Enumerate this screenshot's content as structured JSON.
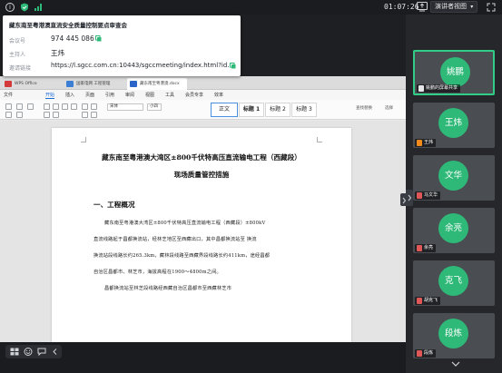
{
  "topbar": {
    "time": "01:07:26",
    "view_label": "演讲者视图",
    "icons": [
      "info-icon",
      "shield-icon",
      "signal-icon",
      "share-screen-icon",
      "chevron-down-icon",
      "fullscreen-icon"
    ]
  },
  "meeting_info": {
    "title": "藏东南至粤港澳直流安全质量控制要点审查会",
    "rows": [
      {
        "label": "会议号",
        "value": "974 445 086"
      },
      {
        "label": "主持人",
        "value": "王炜"
      },
      {
        "label": "邀请链接",
        "value": "https://l.sgcc.com.cn:10443/sgccmeeting/index.html?id..."
      }
    ]
  },
  "document_app": {
    "tabs": [
      {
        "label": "WPS Office",
        "color": "#d33b3b"
      },
      {
        "label": "国家电网 工程管理",
        "color": "#3b7ed3"
      },
      {
        "label": "藏东南至粤港澳.docx",
        "color": "#2a65c7"
      }
    ],
    "menu": [
      "文件",
      "开始",
      "插入",
      "页面",
      "引用",
      "审阅",
      "视图",
      "工具",
      "会员专享",
      "效率"
    ],
    "selected_menu": "开始",
    "font_name": "宋体",
    "font_size": "小四",
    "styles": [
      "正文",
      "标题 1",
      "标题 2",
      "标题 3"
    ],
    "ribbon_right": [
      "查找替换",
      "选择"
    ]
  },
  "document": {
    "title_line1": "藏东南至粤港澳大湾区±800千伏特高压直流输电工程（西藏段）",
    "title_line2": "现场质量管控措施",
    "heading": "一、工程概况",
    "paragraph_lines": [
      "藏东南至粤港澳大湾区±800千伏特高压直流输电工程（西藏段）±800kV",
      "直流线路起于昌都换流站，经林芝地区至西藏出口，其中昌都换流站至   换流",
      "换流站段线路长约265.3km，藏林段线路至西藏界段线路长约411km，途经昌都",
      "自治区昌都市、林芝市，海拔高程在1900～4800m之间。",
      "昌都换流站至林芝段线路经西藏自治区昌都市至西藏林芝市"
    ]
  },
  "participants": [
    {
      "initials": "姚鹏",
      "name": "姚鹏的屏幕共享",
      "active": true,
      "color": "#2fb978"
    },
    {
      "initials": "王炜",
      "name": "王炜",
      "active": false,
      "color": "#2fb978"
    },
    {
      "initials": "文华",
      "name": "马文华",
      "active": false,
      "color": "#2fb978"
    },
    {
      "initials": "余亮",
      "name": "余亮",
      "active": false,
      "color": "#2fb978"
    },
    {
      "initials": "克飞",
      "name": "胡克飞",
      "active": false,
      "color": "#2fb978"
    },
    {
      "initials": "段炼",
      "name": "段炼",
      "active": false,
      "color": "#2fb978"
    }
  ],
  "bottom_toolbar": {
    "icons": [
      "grid-view-icon",
      "reaction-icon",
      "chat-icon",
      "collapse-left-icon"
    ]
  },
  "colors": {
    "accent": "#2fcf88",
    "avatar": "#2fb978",
    "app_bg": "#1e1f22",
    "link_blue": "#1a6bd8"
  }
}
